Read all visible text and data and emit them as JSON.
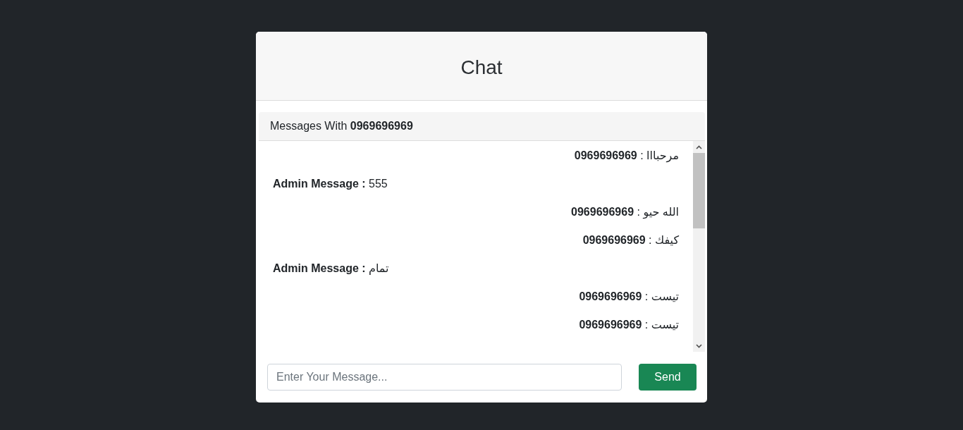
{
  "card": {
    "title": "Chat"
  },
  "conversation": {
    "heading": "Messages With **0969696969**",
    "messages": [
      {
        "kind": "contact",
        "text": "**0969696969** : مرحبااا"
      },
      {
        "kind": "admin",
        "text": "**Admin Message :** 555"
      },
      {
        "kind": "contact",
        "text": "**0969696969** : الله حيو"
      },
      {
        "kind": "contact",
        "text": "**0969696969** : كيفك"
      },
      {
        "kind": "admin",
        "text": "**Admin Message :** تمام"
      },
      {
        "kind": "contact",
        "text": "**0969696969** : تيست"
      },
      {
        "kind": "contact",
        "text": "**0969696969** : تيست"
      }
    ]
  },
  "composer": {
    "placeholder": "Enter Your Message...",
    "button": "Send"
  }
}
